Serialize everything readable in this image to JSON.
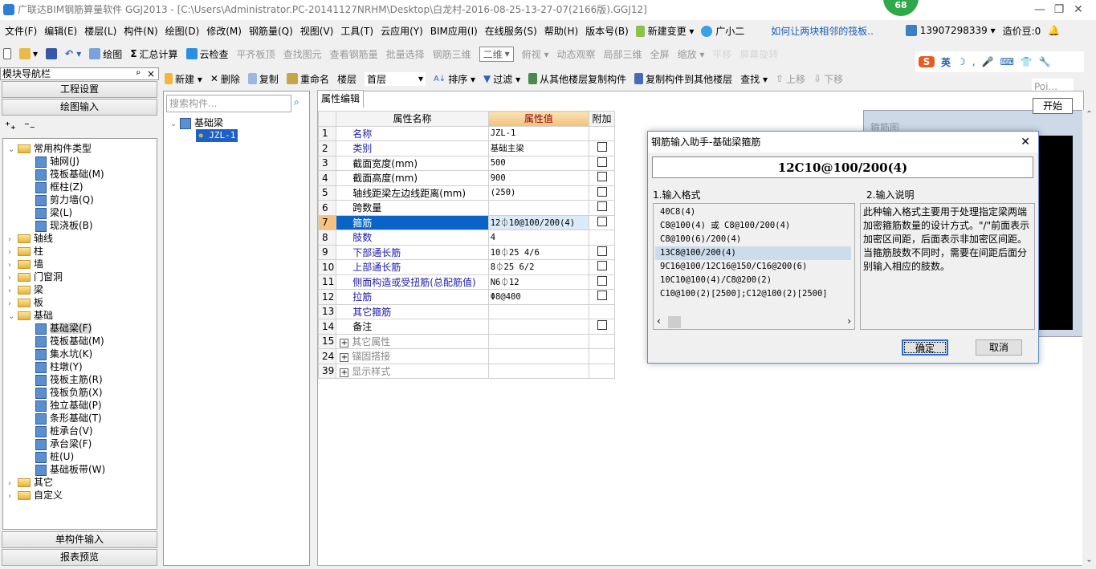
{
  "window": {
    "title": "广联达BIM钢筋算量软件 GGJ2013 - [C:\\Users\\Administrator.PC-20141127NRHM\\Desktop\\白龙村-2016-08-25-13-27-07(2166版).GGJ12]",
    "badge": "68",
    "minimize": "—",
    "restore": "❐",
    "close": "✕"
  },
  "menu": [
    "文件(F)",
    "编辑(E)",
    "楼层(L)",
    "构件(N)",
    "绘图(D)",
    "修改(M)",
    "钢筋量(Q)",
    "视图(V)",
    "工具(T)",
    "云应用(Y)",
    "BIM应用(I)",
    "在线服务(S)",
    "帮助(H)",
    "版本号(B)"
  ],
  "menu_extra": {
    "new_change": "新建变更 ▾",
    "assistant": "广小二",
    "tip": "如何让两块相邻的筏板..",
    "phone": "13907298339 ▾",
    "beans": "造价豆:0"
  },
  "toolbar1": [
    "绘图",
    "汇总计算",
    "云检查",
    "平齐板顶",
    "查找图元",
    "查看钢筋量",
    "批量选择",
    "钢筋三维"
  ],
  "toolbar1_right": {
    "view_mode": "二维",
    "items": [
      "俯视 ▾",
      "动态观察",
      "局部三维",
      "全屏",
      "缩放 ▾",
      "平移",
      "屏幕旋转"
    ]
  },
  "ime": {
    "lang": "英"
  },
  "toolbar2": {
    "new": "新建 ▾",
    "delete": "删除",
    "copy": "复制",
    "rename": "重命名",
    "floor_label": "楼层",
    "floor_value": "首层",
    "sort": "排序 ▾",
    "filter": "过滤 ▾",
    "copy_from": "从其他楼层复制构件",
    "copy_to": "复制构件到其他楼层",
    "find": "查找 ▾",
    "up": "上移",
    "down": "下移"
  },
  "popup": {
    "poi": "Poi...",
    "start": "开始"
  },
  "nav": {
    "header": "模块导航栏",
    "pin": "ᵖ",
    "close": "×",
    "project_settings": "工程设置",
    "draw_input": "绘图输入",
    "single_input": "单构件输入",
    "report_preview": "报表预览",
    "tree": [
      {
        "label": "常用构件类型",
        "level": 0,
        "open": true
      },
      {
        "label": "轴网(J)",
        "level": 1
      },
      {
        "label": "筏板基础(M)",
        "level": 1
      },
      {
        "label": "框柱(Z)",
        "level": 1
      },
      {
        "label": "剪力墙(Q)",
        "level": 1
      },
      {
        "label": "梁(L)",
        "level": 1
      },
      {
        "label": "现浇板(B)",
        "level": 1
      },
      {
        "label": "轴线",
        "level": 0
      },
      {
        "label": "柱",
        "level": 0
      },
      {
        "label": "墙",
        "level": 0
      },
      {
        "label": "门窗洞",
        "level": 0
      },
      {
        "label": "梁",
        "level": 0
      },
      {
        "label": "板",
        "level": 0
      },
      {
        "label": "基础",
        "level": 0,
        "open": true
      },
      {
        "label": "基础梁(F)",
        "level": 1,
        "selected": true
      },
      {
        "label": "筏板基础(M)",
        "level": 1
      },
      {
        "label": "集水坑(K)",
        "level": 1
      },
      {
        "label": "柱墩(Y)",
        "level": 1
      },
      {
        "label": "筏板主筋(R)",
        "level": 1
      },
      {
        "label": "筏板负筋(X)",
        "level": 1
      },
      {
        "label": "独立基础(P)",
        "level": 1
      },
      {
        "label": "条形基础(T)",
        "level": 1
      },
      {
        "label": "桩承台(V)",
        "level": 1
      },
      {
        "label": "承台梁(F)",
        "level": 1
      },
      {
        "label": "桩(U)",
        "level": 1
      },
      {
        "label": "基础板带(W)",
        "level": 1
      },
      {
        "label": "其它",
        "level": 0
      },
      {
        "label": "自定义",
        "level": 0
      }
    ]
  },
  "components": {
    "search_placeholder": "搜索构件...",
    "root": "基础梁",
    "item": "JZL-1"
  },
  "properties": {
    "tab": "属性编辑",
    "headers": [
      "属性名称",
      "属性值",
      "附加"
    ],
    "rows": [
      {
        "n": "1",
        "name": "名称",
        "value": "JZL-1",
        "blue": true,
        "cb": false
      },
      {
        "n": "2",
        "name": "类别",
        "value": "基础主梁",
        "blue": true,
        "cb": true
      },
      {
        "n": "3",
        "name": "截面宽度(mm)",
        "value": "500",
        "cb": true
      },
      {
        "n": "4",
        "name": "截面高度(mm)",
        "value": "900",
        "cb": true
      },
      {
        "n": "5",
        "name": "轴线距梁左边线距离(mm)",
        "value": "(250)",
        "cb": true
      },
      {
        "n": "6",
        "name": "跨数量",
        "value": "",
        "cb": true
      },
      {
        "n": "7",
        "name": "箍筋",
        "value": "12⏀10@100/200(4)",
        "blue": true,
        "cb": true,
        "selected": true
      },
      {
        "n": "8",
        "name": "肢数",
        "value": "4",
        "blue": true,
        "cb": false
      },
      {
        "n": "9",
        "name": "下部通长筋",
        "value": "10⏀25 4/6",
        "blue": true,
        "cb": true
      },
      {
        "n": "10",
        "name": "上部通长筋",
        "value": "8⏀25 6/2",
        "blue": true,
        "cb": true
      },
      {
        "n": "11",
        "name": "侧面构造或受扭筋(总配筋值)",
        "value": "N6⏀12",
        "blue": true,
        "cb": true
      },
      {
        "n": "12",
        "name": "拉筋",
        "value": "Φ8@400",
        "blue": true,
        "cb": true
      },
      {
        "n": "13",
        "name": "其它箍筋",
        "value": "",
        "blue": true,
        "cb": false
      },
      {
        "n": "14",
        "name": "备注",
        "value": "",
        "cb": true
      },
      {
        "n": "15",
        "name": "其它属性",
        "value": "",
        "group": true
      },
      {
        "n": "24",
        "name": "锚固搭接",
        "value": "",
        "group": true
      },
      {
        "n": "39",
        "name": "显示样式",
        "value": "",
        "group": true
      }
    ]
  },
  "stirrup_panel": {
    "title": "箍筋图"
  },
  "dialog": {
    "title": "钢筋输入助手-基础梁箍筋",
    "close": "✕",
    "code": "12C10@100/200(4)",
    "format_label": "1.输入格式",
    "desc_label": "2.输入说明",
    "formats": [
      "40C8(4)",
      "C8@100(4) 或 C8@100/200(4)",
      "C8@100(6)/200(4)",
      "13C8@100/200(4)",
      "9C16@100/12C16@150/C16@200(6)",
      "10C10@100(4)/C8@200(2)",
      "C10@100(2)[2500];C12@100(2)[2500]"
    ],
    "selected_format": 3,
    "description": "此种输入格式主要用于处理指定梁两端加密箍筋数量的设计方式。\"/\"前面表示加密区间距，后面表示非加密区间距。当箍筋肢数不同时，需要在间距后面分别输入相应的肢数。",
    "ok": "确定",
    "cancel": "取消"
  }
}
